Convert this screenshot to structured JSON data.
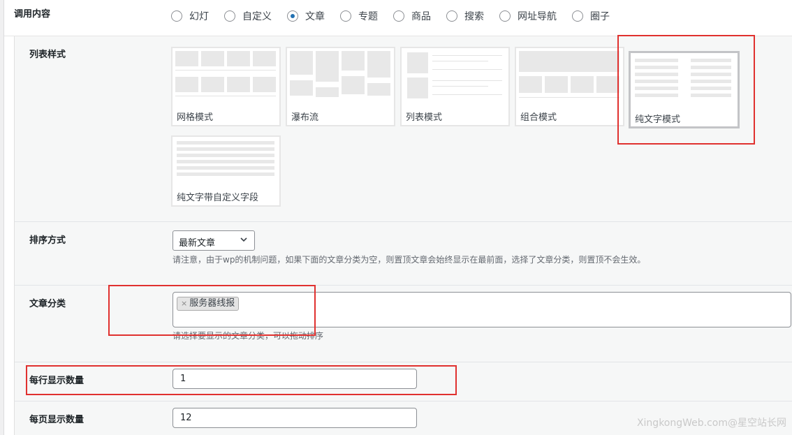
{
  "content_row": {
    "label": "调用内容",
    "options": [
      "幻灯",
      "自定义",
      "文章",
      "专题",
      "商品",
      "搜索",
      "网址导航",
      "圈子"
    ],
    "selected": "文章"
  },
  "list_style": {
    "label": "列表样式",
    "cards": [
      "网格模式",
      "瀑布流",
      "列表模式",
      "组合模式",
      "纯文字模式",
      "纯文字带自定义字段"
    ],
    "selected": "纯文字模式"
  },
  "sort": {
    "label": "排序方式",
    "value": "最新文章",
    "hint": "请注意，由于wp的机制问题，如果下面的文章分类为空，则置顶文章会始终显示在最前面，选择了文章分类，则置顶不会生效。"
  },
  "category": {
    "label": "文章分类",
    "tag_remove": "×",
    "tags": [
      "服务器线报"
    ],
    "hint": "请选择要显示的文章分类，可以拖动排序"
  },
  "per_row": {
    "label": "每行显示数量",
    "value": "1"
  },
  "per_page": {
    "label": "每页显示数量",
    "value": "12"
  },
  "watermark": "XingkongWeb.com@星空站长网",
  "colors": {
    "accent": "#2271b1",
    "highlight": "#e0312f"
  }
}
